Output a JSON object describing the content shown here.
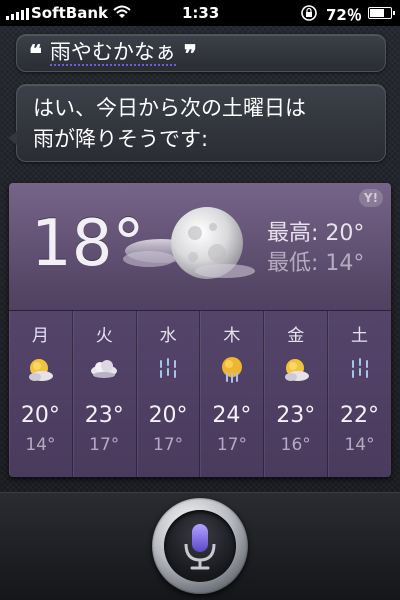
{
  "status_bar": {
    "carrier": "SoftBank",
    "time": "1:33",
    "battery_percent": "72％",
    "battery_level": 0.72
  },
  "conversation": {
    "user_query": "雨やむかなぁ",
    "open_quote": "❝",
    "close_quote": "❞",
    "response_line1": "はい、今日から次の土曜日は",
    "response_line2": "雨が降りそうです:"
  },
  "weather": {
    "provider_badge": "Y!",
    "current_temp": "18°",
    "high_label": "最高:",
    "high_value": " 20°",
    "low_label": "最低:",
    "low_value": " 14°",
    "forecast": [
      {
        "day": "月",
        "icon": "moon-cloud-icon",
        "high": "20°",
        "low": "14°"
      },
      {
        "day": "火",
        "icon": "cloud-icon",
        "high": "23°",
        "low": "17°"
      },
      {
        "day": "水",
        "icon": "rain-icon",
        "high": "20°",
        "low": "17°"
      },
      {
        "day": "木",
        "icon": "moon-rain-icon",
        "high": "24°",
        "low": "17°"
      },
      {
        "day": "金",
        "icon": "moon-cloud-icon",
        "high": "23°",
        "low": "16°"
      },
      {
        "day": "土",
        "icon": "rain-icon",
        "high": "22°",
        "low": "14°"
      }
    ]
  },
  "colors": {
    "accent_purple": "#6b5fd6",
    "widget_purple": "#5a4a6b",
    "mic_purple": "#8f7ae8"
  }
}
